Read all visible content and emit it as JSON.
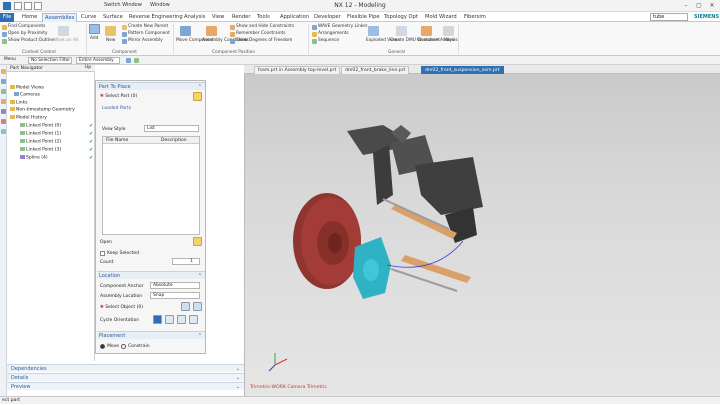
{
  "window": {
    "title": "NX 12 - Modeling",
    "quick_access": {
      "switch_window": "Switch Window",
      "window_menu": "Window"
    },
    "controls": [
      "–",
      "▢",
      "✕"
    ]
  },
  "menu": {
    "file": "File",
    "tabs": [
      "Home",
      "Assemblies",
      "Curve",
      "Surface",
      "Reverse Engineering",
      "Analysis",
      "View",
      "Render",
      "Tools",
      "Application",
      "Developer",
      "Flexible Pipe",
      "Topology Opt",
      "Mold Wizard",
      "Fibersim"
    ],
    "active_tab": "Assemblies",
    "search_value": "tube",
    "brand": "SIEMENS"
  },
  "ribbon": {
    "context_control": {
      "items": [
        "Find Components",
        "Open by Proximity",
        "Show Product Outline"
      ],
      "group_label": "Context Control",
      "work_on_all": "Work on All"
    },
    "component": {
      "add_label": "Add",
      "new_label": "New",
      "items": [
        "Create New Parent",
        "Pattern Component",
        "Mirror Assembly"
      ],
      "group_label": "Component"
    },
    "component_position": {
      "move_label": "Move Component",
      "constraints_label": "Assembly Constraints",
      "items": [
        "Show and Hide Constraints",
        "Remember Constraints",
        "Show Degrees of Freedom"
      ],
      "group_label": "Component Position"
    },
    "general": {
      "items": [
        "WAVE Geometry Linker",
        "Arrangements",
        "Sequence"
      ],
      "exploded_label": "Exploded Views",
      "dmu_label": "Create DMU Worksheet",
      "clearance_label": "Clearance Analysis",
      "more_label": "More",
      "group_label": "General"
    }
  },
  "selection_bar": {
    "menu": "Menu",
    "filter": "No Selection Filter",
    "scope": "Entire Assembly"
  },
  "part_navigator": {
    "title": "Part Navigator",
    "column": "Up",
    "items": [
      {
        "label": "Model Views",
        "indent": 1
      },
      {
        "label": "Cameras",
        "indent": 1
      },
      {
        "label": "Links",
        "indent": 1
      },
      {
        "label": "Non-timestamp Geometry",
        "indent": 1
      },
      {
        "label": "Model History",
        "indent": 1
      },
      {
        "label": "Linked Point (0)",
        "indent": 2,
        "check": "✔"
      },
      {
        "label": "Linked Point (1)",
        "indent": 2,
        "check": "✔"
      },
      {
        "label": "Linked Point (2)",
        "indent": 2,
        "check": "✔"
      },
      {
        "label": "Linked Point (3)",
        "indent": 2,
        "check": "✔"
      },
      {
        "label": "Spline (4)",
        "indent": 2,
        "check": "✔"
      }
    ]
  },
  "bottom_panels": [
    "Dependencies",
    "Details",
    "Preview"
  ],
  "dialog": {
    "part_to_place": {
      "title": "Part To Place",
      "select_part": "Select Part (0)",
      "loaded_parts": "Loaded Parts",
      "view_style_label": "View Style",
      "view_style_value": "List",
      "columns": [
        "File Name",
        "Description"
      ],
      "open_label": "Open",
      "keep_selected": "Keep Selected",
      "count_label": "Count",
      "count_value": "1"
    },
    "location": {
      "title": "Location",
      "anchor_label": "Component Anchor",
      "anchor_value": "Absolute",
      "assembly_location_label": "Assembly Location",
      "assembly_location_value": "Snap",
      "select_object": "Select Object (0)",
      "cycle_orientation": "Cycle Orientation"
    },
    "placement": {
      "title": "Placement",
      "move": "Move",
      "constrain": "Constrain"
    }
  },
  "doc_tabs": [
    {
      "label": "fsam.prt in Assembly top-level.prt",
      "active": false
    },
    {
      "label": "dm02_front_brake_line.prt",
      "active": false
    },
    {
      "label": "dm02_front_suspension_asm.prt",
      "active": true
    }
  ],
  "viewport": {
    "camera_text": "Trimetric-WORK Camera Trimetric"
  },
  "status": {
    "text": "ect part"
  },
  "colors": {
    "accent": "#2f6fb3",
    "check_green": "#2a9d2a",
    "rotor_red": "#9e3b35",
    "caliper_cyan": "#2fb3c4",
    "frame_dark": "#3f3f3f",
    "arm_tan": "#d9a06a"
  }
}
